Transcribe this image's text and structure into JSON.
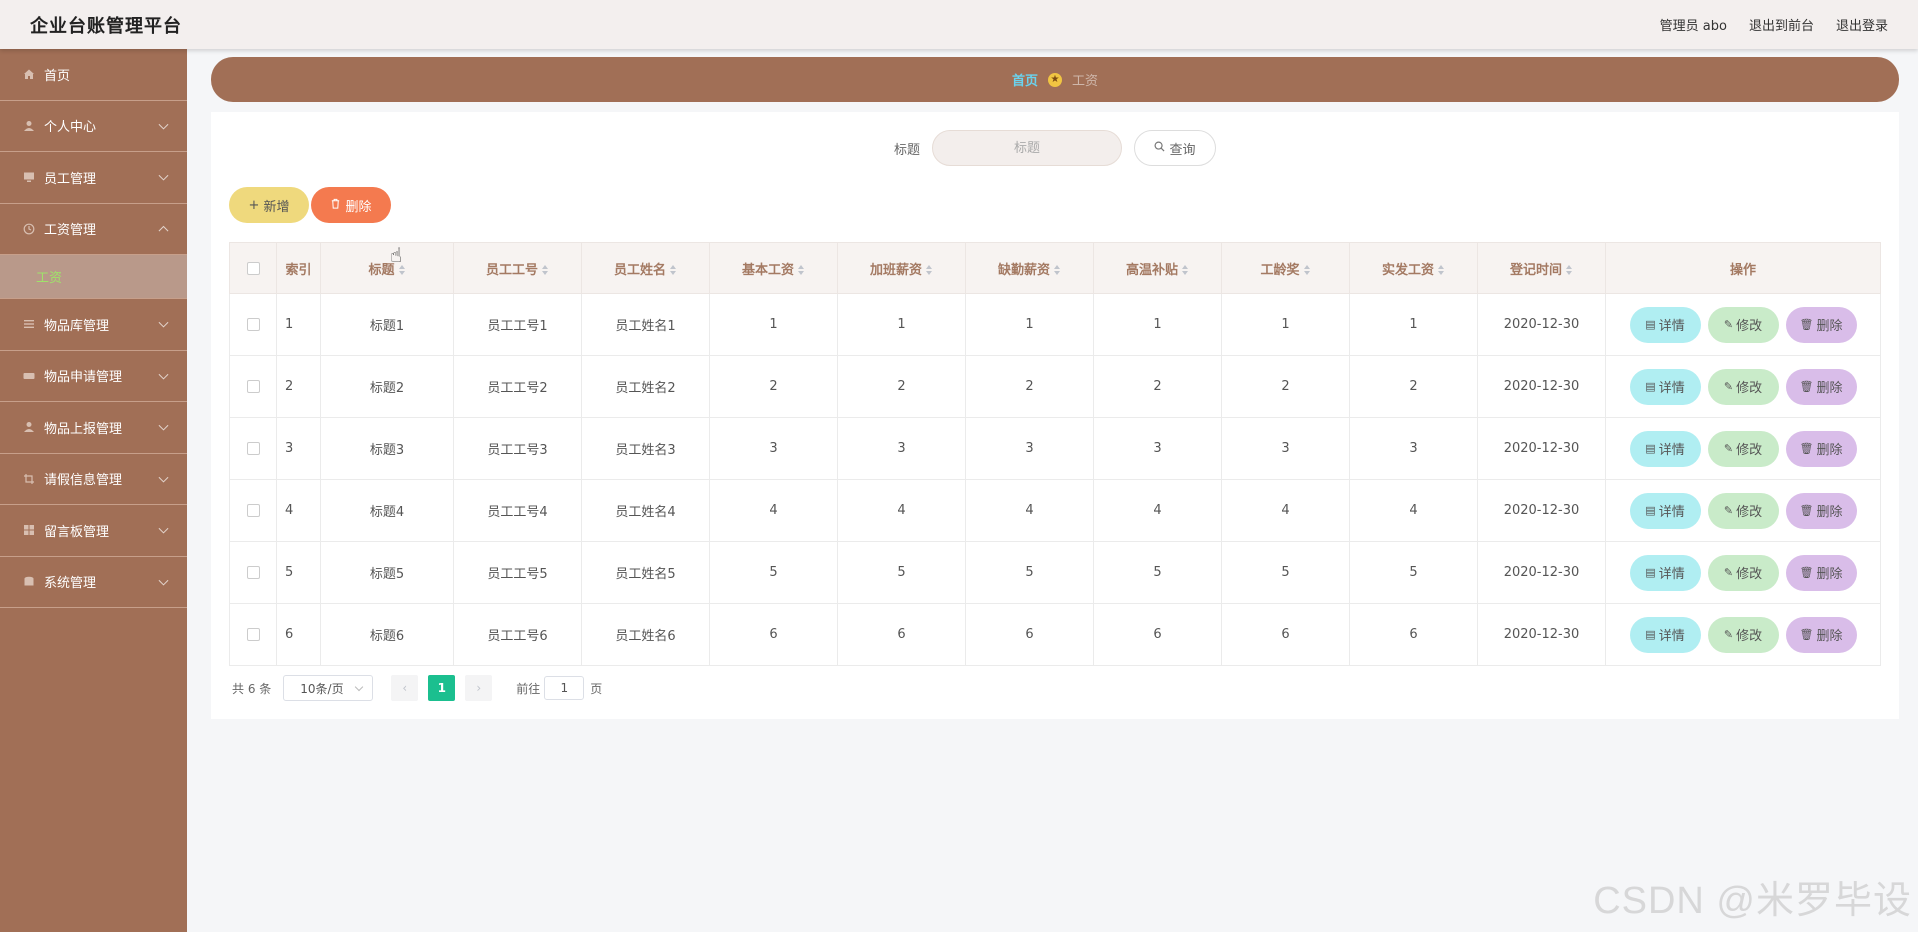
{
  "header": {
    "title": "企业台账管理平台",
    "nav": [
      "管理员 abo",
      "退出到前台",
      "退出登录"
    ]
  },
  "sidebar": {
    "items": [
      {
        "label": "首页",
        "icon": "home-icon"
      },
      {
        "label": "个人中心",
        "icon": "user-icon"
      },
      {
        "label": "员工管理",
        "icon": "monitor-icon"
      },
      {
        "label": "工资管理",
        "icon": "clock-icon"
      },
      {
        "label": "物品库管理",
        "icon": "list-icon"
      },
      {
        "label": "物品申请管理",
        "icon": "keyboard-icon"
      },
      {
        "label": "物品上报管理",
        "icon": "user-icon"
      },
      {
        "label": "请假信息管理",
        "icon": "crop-icon"
      },
      {
        "label": "留言板管理",
        "icon": "grid-icon"
      },
      {
        "label": "系统管理",
        "icon": "database-icon"
      }
    ],
    "sub_item": "工资"
  },
  "breadcrumb": {
    "home": "首页",
    "current": "工资"
  },
  "search": {
    "label": "标题",
    "placeholder": "标题",
    "button": "查询"
  },
  "actions": {
    "add": "新增",
    "delete": "删除"
  },
  "table": {
    "columns": [
      "索引",
      "标题",
      "员工工号",
      "员工姓名",
      "基本工资",
      "加班薪资",
      "缺勤薪资",
      "高温补贴",
      "工龄奖",
      "实发工资",
      "登记时间",
      "操作"
    ],
    "rows": [
      [
        "1",
        "标题1",
        "员工工号1",
        "员工姓名1",
        "1",
        "1",
        "1",
        "1",
        "1",
        "1",
        "2020-12-30"
      ],
      [
        "2",
        "标题2",
        "员工工号2",
        "员工姓名2",
        "2",
        "2",
        "2",
        "2",
        "2",
        "2",
        "2020-12-30"
      ],
      [
        "3",
        "标题3",
        "员工工号3",
        "员工姓名3",
        "3",
        "3",
        "3",
        "3",
        "3",
        "3",
        "2020-12-30"
      ],
      [
        "4",
        "标题4",
        "员工工号4",
        "员工姓名4",
        "4",
        "4",
        "4",
        "4",
        "4",
        "4",
        "2020-12-30"
      ],
      [
        "5",
        "标题5",
        "员工工号5",
        "员工姓名5",
        "5",
        "5",
        "5",
        "5",
        "5",
        "5",
        "2020-12-30"
      ],
      [
        "6",
        "标题6",
        "员工工号6",
        "员工姓名6",
        "6",
        "6",
        "6",
        "6",
        "6",
        "6",
        "2020-12-30"
      ]
    ],
    "row_actions": [
      "详情",
      "修改",
      "删除"
    ]
  },
  "pagination": {
    "total": "共 6 条",
    "page_size": "10条/页",
    "current_page": "1",
    "goto_label": "前往",
    "goto_value": "1",
    "page_suffix": "页"
  },
  "watermark": "CSDN @米罗毕设",
  "colors": {
    "sidebar": "#a16f56",
    "header_bg": "#f3efee",
    "breadcrumb_home": "#6ad3ee",
    "submenu_active": "#9fe36a",
    "add_button": "#efd97d",
    "delete_button": "#f47a4f",
    "detail_button": "#b0eef2",
    "edit_button": "#c9ebc9",
    "row_delete_button": "#d9bde9",
    "page_active": "#1bbf8f"
  }
}
